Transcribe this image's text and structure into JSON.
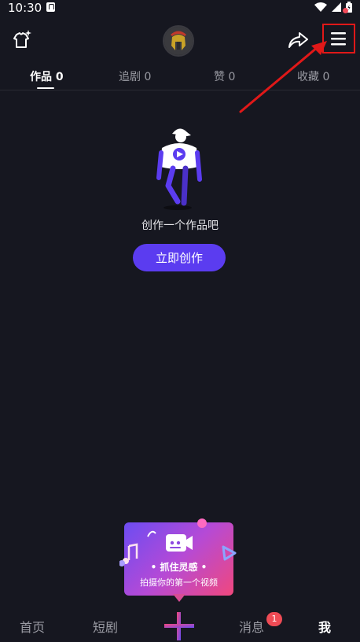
{
  "status_bar": {
    "time": "10:30"
  },
  "header": {
    "shirt_icon": "shirt-sparkle-icon",
    "avatar_icon": "spartan-helmet-avatar",
    "share_icon": "share-arrow-icon",
    "menu_icon": "hamburger-menu-icon"
  },
  "tabs": [
    {
      "label": "作品 0",
      "active": true
    },
    {
      "label": "追剧 0",
      "active": false
    },
    {
      "label": "赞 0",
      "active": false
    },
    {
      "label": "收藏 0",
      "active": false
    }
  ],
  "empty_state": {
    "message": "创作一个作品吧",
    "button_label": "立即创作"
  },
  "promo": {
    "title": "• 抓住灵感 •",
    "subtitle": "拍摄你的第一个视频"
  },
  "bottom_nav": {
    "items": [
      {
        "label": "首页",
        "active": false
      },
      {
        "label": "短剧",
        "active": false
      },
      {
        "label": "消息",
        "active": false
      },
      {
        "label": "我",
        "active": true
      }
    ],
    "message_badge": "1"
  },
  "colors": {
    "background": "#161720",
    "accent": "#5b3cf0",
    "badge": "#ee4b55",
    "annotation": "#e01818"
  }
}
